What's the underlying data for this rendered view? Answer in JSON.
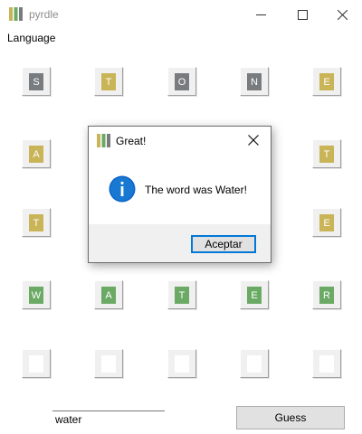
{
  "window": {
    "title": "pyrdle",
    "logo_colors": [
      "#c9b458",
      "#6aaa64",
      "#787c7e"
    ]
  },
  "menu": {
    "items": [
      "Language"
    ]
  },
  "board": {
    "colors": {
      "correct": "#6aaa64",
      "present": "#c9b458",
      "absent": "#787c7e",
      "empty": "#ffffff"
    },
    "rows": [
      [
        {
          "letter": "S",
          "state": "absent"
        },
        {
          "letter": "T",
          "state": "present"
        },
        {
          "letter": "O",
          "state": "absent"
        },
        {
          "letter": "N",
          "state": "absent"
        },
        {
          "letter": "E",
          "state": "present"
        }
      ],
      [
        {
          "letter": "A",
          "state": "present"
        },
        {
          "letter": "",
          "state": "hidden"
        },
        {
          "letter": "",
          "state": "hidden"
        },
        {
          "letter": "",
          "state": "hidden"
        },
        {
          "letter": "T",
          "state": "present"
        }
      ],
      [
        {
          "letter": "T",
          "state": "present"
        },
        {
          "letter": "",
          "state": "hidden"
        },
        {
          "letter": "",
          "state": "hidden"
        },
        {
          "letter": "",
          "state": "hidden"
        },
        {
          "letter": "E",
          "state": "present"
        }
      ],
      [
        {
          "letter": "W",
          "state": "correct"
        },
        {
          "letter": "A",
          "state": "correct"
        },
        {
          "letter": "T",
          "state": "correct"
        },
        {
          "letter": "E",
          "state": "correct"
        },
        {
          "letter": "R",
          "state": "correct"
        }
      ],
      [
        {
          "letter": "",
          "state": "empty"
        },
        {
          "letter": "",
          "state": "empty"
        },
        {
          "letter": "",
          "state": "empty"
        },
        {
          "letter": "",
          "state": "empty"
        },
        {
          "letter": "",
          "state": "empty"
        }
      ]
    ]
  },
  "input": {
    "value": "water"
  },
  "guess_button": {
    "label": "Guess"
  },
  "dialog": {
    "title": "Great!",
    "message": "The word was Water!",
    "icon": "info-icon",
    "accept_label": "Aceptar"
  }
}
